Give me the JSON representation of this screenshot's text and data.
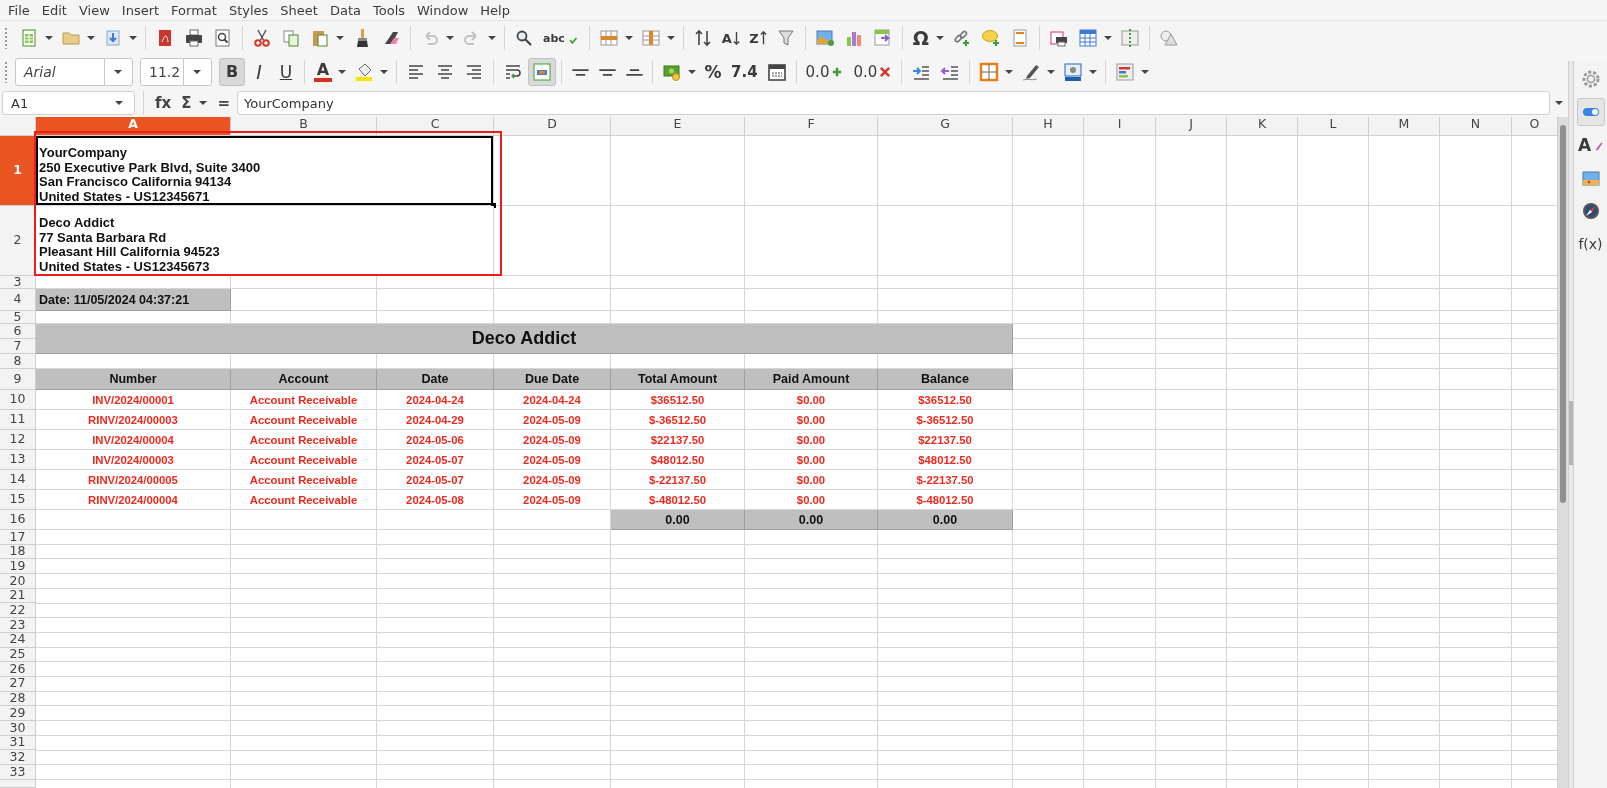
{
  "menu": [
    "File",
    "Edit",
    "View",
    "Insert",
    "Format",
    "Styles",
    "Sheet",
    "Data",
    "Tools",
    "Window",
    "Help"
  ],
  "standard_toolbar": [
    [
      {
        "kind": "spreadsheet",
        "dropdown": true,
        "disabled": false
      },
      {
        "kind": "folder",
        "dropdown": true,
        "disabled": false
      },
      {
        "kind": "save",
        "dropdown": true,
        "disabled": false
      }
    ],
    [
      {
        "kind": "pdf",
        "dropdown": false,
        "disabled": false
      },
      {
        "kind": "printer",
        "dropdown": false,
        "disabled": false
      },
      {
        "kind": "preview",
        "dropdown": false,
        "disabled": false
      }
    ],
    [
      {
        "kind": "scissors",
        "dropdown": false,
        "disabled": false
      },
      {
        "kind": "copy",
        "dropdown": false,
        "disabled": false
      },
      {
        "kind": "paste",
        "dropdown": true,
        "disabled": false
      },
      {
        "kind": "brush",
        "dropdown": false,
        "disabled": false
      },
      {
        "kind": "eraser",
        "dropdown": false,
        "disabled": false
      }
    ],
    [
      {
        "kind": "undo",
        "dropdown": true,
        "disabled": true
      },
      {
        "kind": "redo",
        "dropdown": true,
        "disabled": true
      }
    ],
    [
      {
        "kind": "find",
        "dropdown": false,
        "disabled": false
      },
      {
        "kind": "spellcheck",
        "label": "abc",
        "dropdown": false,
        "disabled": false
      }
    ],
    [
      {
        "kind": "rows",
        "dropdown": true,
        "disabled": false
      },
      {
        "kind": "columns",
        "dropdown": true,
        "disabled": false
      }
    ],
    [
      {
        "kind": "sort",
        "dropdown": false,
        "disabled": false
      },
      {
        "kind": "sort_asc",
        "label": "A",
        "dropdown": false,
        "disabled": false
      },
      {
        "kind": "sort_desc",
        "label": "Z",
        "dropdown": false,
        "disabled": false
      },
      {
        "kind": "filter",
        "dropdown": false,
        "disabled": false
      }
    ],
    [
      {
        "kind": "image",
        "dropdown": false,
        "disabled": false
      },
      {
        "kind": "chart",
        "dropdown": false,
        "disabled": false
      },
      {
        "kind": "pivot",
        "dropdown": false,
        "disabled": false
      }
    ],
    [
      {
        "kind": "special",
        "label": "Ω",
        "dropdown": true,
        "disabled": false
      },
      {
        "kind": "link",
        "dropdown": false,
        "disabled": false
      },
      {
        "kind": "comment",
        "dropdown": false,
        "disabled": false
      },
      {
        "kind": "header",
        "dropdown": false,
        "disabled": false
      }
    ],
    [
      {
        "kind": "print_area",
        "dropdown": false,
        "disabled": false
      },
      {
        "kind": "freeze",
        "dropdown": true,
        "disabled": false
      },
      {
        "kind": "split",
        "dropdown": false,
        "disabled": false
      }
    ],
    [
      {
        "kind": "shapes",
        "dropdown": false,
        "disabled": false
      }
    ]
  ],
  "font_name": "Arial",
  "font_size": "11.2",
  "format_toolbar": [
    [
      {
        "kind": "bold",
        "label": "B",
        "dropdown": false,
        "pressed": true
      },
      {
        "kind": "italic",
        "label": "I",
        "dropdown": false,
        "pressed": false
      },
      {
        "kind": "underline",
        "label": "U",
        "dropdown": false,
        "pressed": false
      }
    ],
    [
      {
        "kind": "font_color",
        "label": "A",
        "dropdown": true,
        "pressed": false
      },
      {
        "kind": "highlight",
        "dropdown": true,
        "pressed": false
      }
    ],
    [
      {
        "kind": "align_left",
        "dropdown": false,
        "pressed": false
      },
      {
        "kind": "align_center",
        "dropdown": false,
        "pressed": false
      },
      {
        "kind": "align_right",
        "dropdown": false,
        "pressed": false
      }
    ],
    [
      {
        "kind": "wrap",
        "dropdown": false,
        "pressed": false
      },
      {
        "kind": "merge",
        "dropdown": false,
        "pressed": true
      }
    ],
    [
      {
        "kind": "align_top",
        "dropdown": false,
        "pressed": false
      },
      {
        "kind": "align_middle",
        "dropdown": false,
        "pressed": false
      },
      {
        "kind": "align_bottom",
        "dropdown": false,
        "pressed": false
      }
    ],
    [
      {
        "kind": "currency",
        "dropdown": true,
        "pressed": false
      },
      {
        "kind": "percent",
        "label": "%",
        "dropdown": false,
        "pressed": false
      },
      {
        "kind": "number",
        "label": "7.4",
        "dropdown": false,
        "pressed": false
      },
      {
        "kind": "date",
        "dropdown": false,
        "pressed": false
      }
    ],
    [
      {
        "kind": "add_decimal",
        "label": "0.0",
        "dropdown": false,
        "pressed": false
      },
      {
        "kind": "remove_decimal",
        "label": "0.0",
        "dropdown": false,
        "pressed": false
      }
    ],
    [
      {
        "kind": "indent",
        "dropdown": false,
        "pressed": false
      },
      {
        "kind": "outdent",
        "dropdown": false,
        "pressed": false
      }
    ],
    [
      {
        "kind": "borders",
        "dropdown": true,
        "pressed": false
      },
      {
        "kind": "border_style",
        "dropdown": true,
        "pressed": false
      },
      {
        "kind": "border_color",
        "dropdown": true,
        "pressed": false
      }
    ],
    [
      {
        "kind": "conditional",
        "dropdown": true,
        "pressed": false
      }
    ]
  ],
  "formula_bar": {
    "name_box": "A1",
    "buttons": [
      {
        "label": "fx",
        "dropdown": false
      },
      {
        "label": "Σ",
        "dropdown": true
      },
      {
        "label": "=",
        "dropdown": false
      }
    ],
    "content": "YourCompany"
  },
  "sidebar": [
    {
      "kind": "settings",
      "selected": false
    },
    {
      "kind": "properties",
      "selected": true
    },
    {
      "kind": "styles",
      "label": "A",
      "selected": false
    },
    {
      "kind": "gallery",
      "selected": false
    },
    {
      "kind": "navigator",
      "selected": false
    },
    {
      "kind": "functions",
      "label": "f(x)",
      "selected": false
    }
  ],
  "sheet": {
    "columns": [
      {
        "label": "A",
        "selected": true
      },
      {
        "label": "B",
        "selected": false
      },
      {
        "label": "C",
        "selected": false
      },
      {
        "label": "D",
        "selected": false
      },
      {
        "label": "E",
        "selected": false
      },
      {
        "label": "F",
        "selected": false
      },
      {
        "label": "G",
        "selected": false
      },
      {
        "label": "H",
        "selected": false
      },
      {
        "label": "I",
        "selected": false
      },
      {
        "label": "J",
        "selected": false
      },
      {
        "label": "K",
        "selected": false
      },
      {
        "label": "L",
        "selected": false
      },
      {
        "label": "M",
        "selected": false
      },
      {
        "label": "N",
        "selected": false
      },
      {
        "label": "O",
        "selected": false
      }
    ],
    "rows": [
      {
        "label": "1",
        "selected": true
      },
      {
        "label": "2",
        "selected": false
      },
      {
        "label": "3",
        "selected": false
      },
      {
        "label": "4",
        "selected": false
      },
      {
        "label": "5",
        "selected": false
      },
      {
        "label": "6",
        "selected": false
      },
      {
        "label": "7",
        "selected": false
      },
      {
        "label": "8",
        "selected": false
      },
      {
        "label": "9",
        "selected": false
      },
      {
        "label": "10",
        "selected": false
      },
      {
        "label": "11",
        "selected": false
      },
      {
        "label": "12",
        "selected": false
      },
      {
        "label": "13",
        "selected": false
      },
      {
        "label": "14",
        "selected": false
      },
      {
        "label": "15",
        "selected": false
      },
      {
        "label": "16",
        "selected": false
      },
      {
        "label": "17",
        "selected": false
      },
      {
        "label": "18",
        "selected": false
      },
      {
        "label": "19",
        "selected": false
      },
      {
        "label": "20",
        "selected": false
      },
      {
        "label": "21",
        "selected": false
      },
      {
        "label": "22",
        "selected": false
      },
      {
        "label": "23",
        "selected": false
      },
      {
        "label": "24",
        "selected": false
      },
      {
        "label": "25",
        "selected": false
      },
      {
        "label": "26",
        "selected": false
      },
      {
        "label": "27",
        "selected": false
      },
      {
        "label": "28",
        "selected": false
      },
      {
        "label": "29",
        "selected": false
      },
      {
        "label": "30",
        "selected": false
      },
      {
        "label": "31",
        "selected": false
      },
      {
        "label": "32",
        "selected": false
      },
      {
        "label": "33",
        "selected": false
      }
    ],
    "company_address": [
      "YourCompany",
      "250 Executive Park Blvd, Suite 3400",
      "San Francisco California 94134",
      "United States - US12345671"
    ],
    "customer_address": [
      "Deco Addict",
      "77 Santa Barbara Rd",
      "Pleasant Hill California 94523",
      "United States - US12345673"
    ],
    "date": "Date: 11/05/2024 04:37:21",
    "title": "Deco Addict",
    "table": {
      "columns": [
        "Number",
        "Account",
        "Date",
        "Due Date",
        "Total Amount",
        "Paid Amount",
        "Balance"
      ],
      "rows": [
        [
          "INV/2024/00001",
          "Account Receivable",
          "2024-04-24",
          "2024-04-24",
          "$36512.50",
          "$0.00",
          "$36512.50"
        ],
        [
          "RINV/2024/00003",
          "Account Receivable",
          "2024-04-29",
          "2024-05-09",
          "$-36512.50",
          "$0.00",
          "$-36512.50"
        ],
        [
          "INV/2024/00004",
          "Account Receivable",
          "2024-05-06",
          "2024-05-09",
          "$22137.50",
          "$0.00",
          "$22137.50"
        ],
        [
          "INV/2024/00003",
          "Account Receivable",
          "2024-05-07",
          "2024-05-09",
          "$48012.50",
          "$0.00",
          "$48012.50"
        ],
        [
          "RINV/2024/00005",
          "Account Receivable",
          "2024-05-07",
          "2024-05-09",
          "$-22137.50",
          "$0.00",
          "$-22137.50"
        ],
        [
          "RINV/2024/00004",
          "Account Receivable",
          "2024-05-08",
          "2024-05-09",
          "$-48012.50",
          "$0.00",
          "$-48012.50"
        ]
      ],
      "totals": [
        "0.00",
        "0.00",
        "0.00"
      ]
    }
  }
}
